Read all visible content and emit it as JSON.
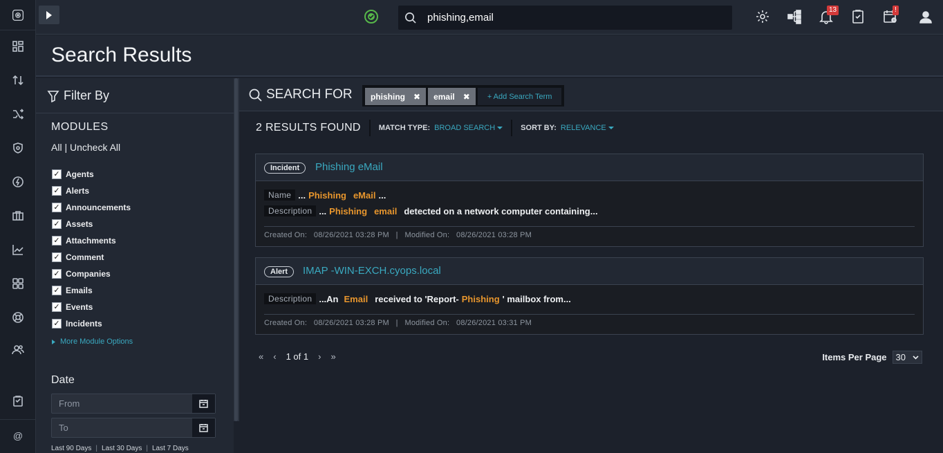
{
  "search": {
    "value": "phishing,email"
  },
  "header": {
    "notifications_count": "13",
    "alerts_badge": "!"
  },
  "page": {
    "title": "Search Results"
  },
  "filter": {
    "heading": "Filter By",
    "modules_heading": "MODULES",
    "check_all": "All",
    "uncheck_all": "Uncheck All",
    "modules": [
      {
        "label": "Agents"
      },
      {
        "label": "Alerts"
      },
      {
        "label": "Announcements"
      },
      {
        "label": "Assets"
      },
      {
        "label": "Attachments"
      },
      {
        "label": "Comment"
      },
      {
        "label": "Companies"
      },
      {
        "label": "Emails"
      },
      {
        "label": "Events"
      },
      {
        "label": "Incidents"
      }
    ],
    "more_modules": "More Module Options",
    "date_heading": "Date",
    "from_placeholder": "From",
    "to_placeholder": "To",
    "quick_ranges": [
      "Last 90 Days",
      "Last 30 Days",
      "Last 7 Days"
    ]
  },
  "searchfor": {
    "label": "SEARCH FOR",
    "terms": [
      "phishing",
      "email"
    ],
    "add_term": "+ Add Search Term"
  },
  "results": {
    "count_label": "2 RESULTS FOUND",
    "match_type_label": "MATCH TYPE:",
    "match_type_value": "BROAD SEARCH",
    "sort_by_label": "SORT BY:",
    "sort_by_value": "RELEVANCE",
    "items": [
      {
        "type": "Incident",
        "title": "Phishing eMail",
        "name_label": "Name",
        "name_pre": "...",
        "name_hl1": "Phishing",
        "name_hl2": "eMail",
        "name_post": "...",
        "desc_label": "Description",
        "desc_pre": "...",
        "desc_hl1": "Phishing",
        "desc_hl2": "email",
        "desc_post": "detected on a network computer containing...",
        "meta": "Created On:   08/26/2021 03:28 PM   |   Modified On:   08/26/2021 03:28 PM"
      },
      {
        "type": "Alert",
        "title": "IMAP -WIN-EXCH.cyops.local",
        "desc_label": "Description",
        "desc_pre": "...An",
        "desc_hl1": "Email",
        "desc_mid": "received to 'Report-",
        "desc_hl2": "Phishing",
        "desc_post": "' mailbox from...",
        "meta": "Created On:   08/26/2021 03:28 PM   |   Modified On:   08/26/2021 03:31 PM"
      }
    ]
  },
  "pagination": {
    "page_label": "1 of 1",
    "items_per_page_label": "Items Per Page",
    "items_per_page_value": "30"
  }
}
